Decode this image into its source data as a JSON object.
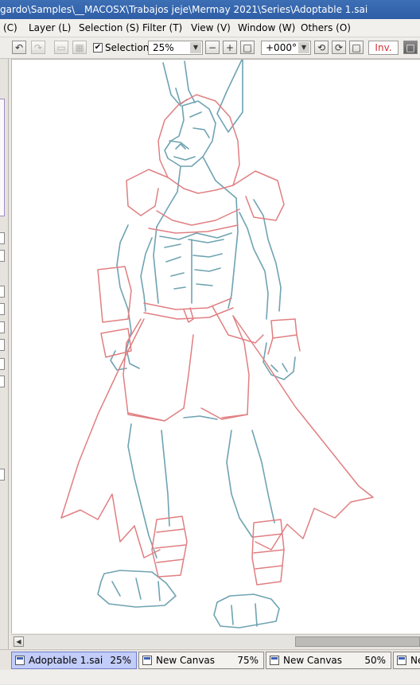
{
  "window": {
    "title": "gardo\\Samples\\__MACOSX\\Trabajos jeje\\Mermay 2021\\Series\\Adoptable 1.sai"
  },
  "menu": [
    {
      "label": "(C)"
    },
    {
      "label": "Layer (L)"
    },
    {
      "label": "Selection (S)"
    },
    {
      "label": "Filter (T)"
    },
    {
      "label": "View (V)"
    },
    {
      "label": "Window (W)"
    },
    {
      "label": "Others (O)"
    }
  ],
  "toolbar": {
    "selection_label": "Selection",
    "selection_checked": true,
    "zoom_value": "25%",
    "rotation_value": "+000°",
    "invert_label": "Inv."
  },
  "document_tabs": [
    {
      "name": "Adoptable 1.sai",
      "zoom": "25%",
      "active": true
    },
    {
      "name": "New Canvas",
      "zoom": "75%",
      "active": false
    },
    {
      "name": "New Canvas",
      "zoom": "50%",
      "active": false
    },
    {
      "name": "Ne",
      "zoom": "",
      "active": false
    }
  ],
  "colors": {
    "sketch_red": "#e07f82",
    "sketch_blue": "#6fa3b2",
    "active_tab": "#c3cdfa",
    "invert_text": "#d23131"
  },
  "icons": {
    "undo": "undo-icon",
    "redo": "redo-icon",
    "zoom_out": "minus-icon",
    "zoom_in": "plus-icon",
    "rotate_ccw": "rotate-left-icon",
    "rotate_cw": "rotate-right-icon"
  }
}
